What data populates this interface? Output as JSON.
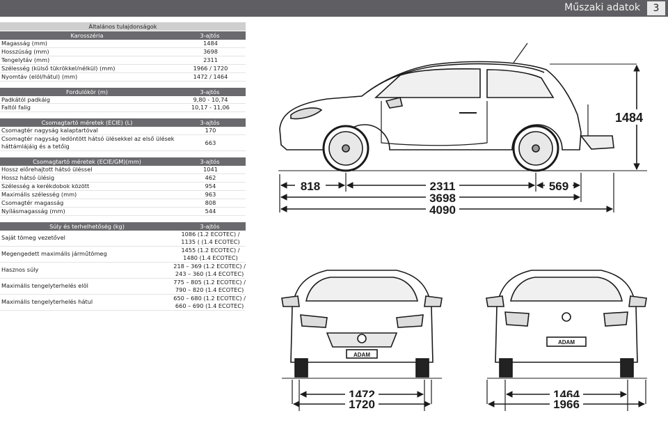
{
  "header": {
    "title": "Műszaki adatok",
    "page_number": "3"
  },
  "general_title": "Általános tulajdonságok",
  "sections": [
    {
      "title": "Karosszéria",
      "col": "3-ajtós",
      "rows": [
        {
          "label": "Magasság (mm)",
          "value": "1484"
        },
        {
          "label": "Hosszúság (mm)",
          "value": "3698"
        },
        {
          "label": "Tengelytáv (mm)",
          "value": "2311"
        },
        {
          "label": "Szélesség (külső tükrökkel/nélkül) (mm)",
          "value": "1966 / 1720"
        },
        {
          "label": "Nyomtáv (elöl/hátul) (mm)",
          "value": "1472 / 1464"
        }
      ]
    },
    {
      "title": "Fordulókör (m)",
      "col": "3-ajtós",
      "rows": [
        {
          "label": "Padkától padkáig",
          "value": "9,80 - 10,74"
        },
        {
          "label": "Faltól falig",
          "value": "10,17 - 11,06"
        }
      ]
    },
    {
      "title": "Csomagtartó méretek (ECIE) (L)",
      "col": "3-ajtós",
      "rows": [
        {
          "label": "Csomagtér nagyság kalaptartóval",
          "value": "170"
        },
        {
          "label": "Csomagtér nagyság ledöntött hátsó ülésekkel az első ülések háttámlájáig és a tetőig",
          "value": "663"
        }
      ]
    },
    {
      "title": "Csomagtartó méretek (ECIE/GM)(mm)",
      "col": "3-ajtós",
      "rows": [
        {
          "label": "Hossz előrehajtott hátsó üléssel",
          "value": "1041"
        },
        {
          "label": "Hossz hátsó ülésig",
          "value": "462"
        },
        {
          "label": "Szélesség a kerékdobok között",
          "value": "954"
        },
        {
          "label": "Maximális szélesség (mm)",
          "value": "963"
        },
        {
          "label": "Csomagtér magasság",
          "value": "808"
        },
        {
          "label": "Nyílásmagasság (mm)",
          "value": "544"
        }
      ]
    },
    {
      "title": "Súly és terhelhetőség (kg)",
      "col": "3-ajtós",
      "rows": [
        {
          "label": "Saját tömeg vezetővel",
          "value": "1086 (1.2 ECOTEC) /",
          "value2": "1135 ( (1.4 ECOTEC)"
        },
        {
          "label": "Megengedett maximális jármű­tömeg",
          "value": "1455 (1.2 ECOTEC) /",
          "value2": "1480 (1.4 ECOTEC)"
        },
        {
          "label": "Hasznos súly",
          "value": "218 – 369 (1.2 ECOTEC) /",
          "value2": "243 – 360 (1.4 ECOTEC)"
        },
        {
          "label": "Maximális tengelyterhelés elöl",
          "value": "775 – 805 (1.2 ECOTEC) /",
          "value2": "790 – 820 (1.4 ECOTEC)"
        },
        {
          "label": "Maximális tengelyterhelés hátul",
          "value": "650 – 680 (1.2 ECOTEC) /",
          "value2": "660 – 690 (1.4 ECOTEC)"
        }
      ]
    }
  ],
  "diagram": {
    "height": "1484",
    "front_overhang": "818",
    "wheelbase": "2311",
    "rear_overhang": "569",
    "length": "3698",
    "length_with_carrier": "4090",
    "front_track": "1472",
    "width_front": "1720",
    "rear_track": "1464",
    "width_mirrors": "1966",
    "plate": "ADAM"
  }
}
